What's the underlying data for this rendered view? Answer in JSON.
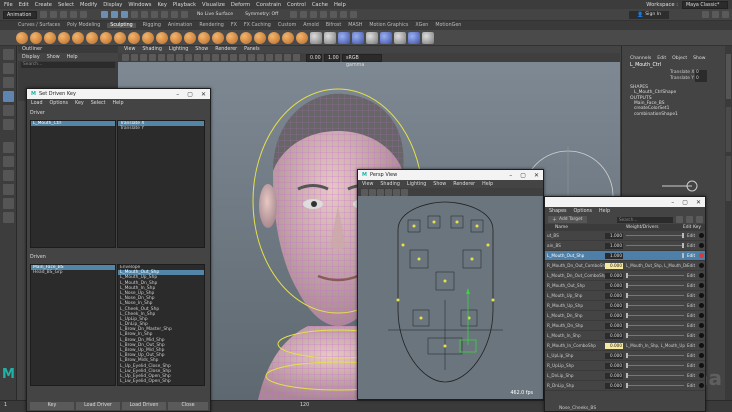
{
  "menubar": {
    "items": [
      "File",
      "Edit",
      "Create",
      "Select",
      "Modify",
      "Display",
      "Windows",
      "Key",
      "Playback",
      "Visualize",
      "Deform",
      "Constrain",
      "Control",
      "Cache",
      "Help"
    ],
    "workspace_label": "Workspace :",
    "workspace_value": "Maya Classic*"
  },
  "statusline": {
    "mode": "Animation",
    "no_live_surface": "No Live Surface",
    "symmetry": "Symmetry: Off",
    "sign_in": "Sign In"
  },
  "shelf": {
    "tabs": [
      "Curves / Surfaces",
      "Poly Modeling",
      "Sculpting",
      "Rigging",
      "Animation",
      "Rendering",
      "FX",
      "FX Caching",
      "Custom",
      "Arnold",
      "Bifrost",
      "MASH",
      "Motion Graphics",
      "XGen",
      "MotionGen"
    ],
    "active_tab": "Sculpting"
  },
  "outliner": {
    "title": "Outliner",
    "menu": [
      "Display",
      "Show",
      "Help"
    ],
    "search_placeholder": "Search..."
  },
  "viewport": {
    "menu": [
      "View",
      "Shading",
      "Lighting",
      "Show",
      "Renderer",
      "Panels"
    ],
    "colorspace": "sRGB gamma",
    "val_a": "0.00",
    "val_b": "1.00"
  },
  "sdk": {
    "title": "Set Driven Key",
    "menu": [
      "Load",
      "Options",
      "Key",
      "Select",
      "Help"
    ],
    "driver_label": "Driver",
    "driver_object": "L_Mouth_Ctrl",
    "driver_attrs": [
      "Translate X",
      "Translate Y"
    ],
    "driven_label": "Driven",
    "driven_objects": [
      "Main_Face_BS",
      "Head_BS_Grp"
    ],
    "driven_attrs": [
      "Envelope",
      "L_Mouth_Out_Shp",
      "L_Mouth_Up_Shp",
      "L_Mouth_Dn_Shp",
      "L_Mouth_In_Shp",
      "L_Nose_Up_Shp",
      "L_Nose_Dn_Shp",
      "L_Nose_In_Shp",
      "L_Cheek_Out_Shp",
      "L_Cheek_In_Shp",
      "L_UpLip_Shp",
      "L_DnLip_Shp",
      "L_Brow_Dn_Master_Shp",
      "L_Brow_In_Shp",
      "L_Brow_Dn_Mid_Shp",
      "L_Brow_Dn_Out_Shp",
      "L_Brow_Up_Mid_Shp",
      "L_Brow_Up_Out_Shp",
      "L_Brow_Mids_Shp",
      "L_Up_Eyelid_Close_Shp",
      "L_Lw_Eyelid_Close_Shp",
      "L_Up_Eyelid_Open_Shp",
      "L_Lw_Eyelid_Open_Shp"
    ],
    "buttons": [
      "Key",
      "Load Driver",
      "Load Driven",
      "Close"
    ]
  },
  "persp": {
    "title": "Persp View",
    "menu": [
      "View",
      "Shading",
      "Lighting",
      "Show",
      "Renderer",
      "Help"
    ],
    "fps": "462.0 fps"
  },
  "shape_editor": {
    "menu": [
      "Shapes",
      "Options",
      "Help"
    ],
    "add_target": "Add Target",
    "search_placeholder": "Search...",
    "col_name": "Name",
    "col_weight": "Weight/Drivers",
    "col_edit": "Edit",
    "col_key": "Key",
    "rows": [
      {
        "name": "ut_BS",
        "value": "1.000",
        "slider": 1.0,
        "yellow": false,
        "driver": "",
        "selected": false,
        "key": "dark"
      },
      {
        "name": "ain_BS",
        "value": "1.000",
        "slider": 1.0,
        "yellow": false,
        "driver": "",
        "selected": false,
        "key": "dark"
      },
      {
        "name": "L_Mouth_Out_Shp",
        "value": "1.000",
        "slider": 1.0,
        "yellow": false,
        "driver": "",
        "selected": true,
        "key": "red"
      },
      {
        "name": "R_Mouth_Dn_Out_ComboShp",
        "value": "0.000",
        "slider": 0,
        "yellow": true,
        "driver": "L_Mouth_Out_Shp, L_Mouth_Dn",
        "selected": false,
        "key": "dark"
      },
      {
        "name": "L_Mouth_Dn_Out_ComboShp",
        "value": "0.000",
        "slider": 0,
        "yellow": false,
        "driver": "",
        "selected": false,
        "key": "dark"
      },
      {
        "name": "R_Mouth_Out_Shp",
        "value": "0.000",
        "slider": 0,
        "yellow": false,
        "driver": "",
        "selected": false,
        "key": "dark"
      },
      {
        "name": "L_Mouth_Up_Shp",
        "value": "0.000",
        "slider": 0,
        "yellow": false,
        "driver": "",
        "selected": false,
        "key": "dark"
      },
      {
        "name": "R_Mouth_Up_Shp",
        "value": "0.000",
        "slider": 0,
        "yellow": false,
        "driver": "",
        "selected": false,
        "key": "dark"
      },
      {
        "name": "L_Mouth_Dn_Shp",
        "value": "0.000",
        "slider": 0,
        "yellow": false,
        "driver": "",
        "selected": false,
        "key": "dark"
      },
      {
        "name": "R_Mouth_Dn_Shp",
        "value": "0.000",
        "slider": 0,
        "yellow": false,
        "driver": "",
        "selected": false,
        "key": "dark"
      },
      {
        "name": "L_Mouth_In_Shp",
        "value": "0.000",
        "slider": 0,
        "yellow": false,
        "driver": "",
        "selected": false,
        "key": "dark"
      },
      {
        "name": "R_Mouth_In_ComboShp",
        "value": "0.000",
        "slider": 0,
        "yellow": true,
        "driver": "L_Mouth_In_Shp, L_Mouth_Up",
        "selected": false,
        "key": "dark"
      },
      {
        "name": "L_UpLip_Shp",
        "value": "0.000",
        "slider": 0,
        "yellow": false,
        "driver": "",
        "selected": false,
        "key": "dark"
      },
      {
        "name": "R_UpLip_Shp",
        "value": "0.000",
        "slider": 0,
        "yellow": false,
        "driver": "",
        "selected": false,
        "key": "dark"
      },
      {
        "name": "L_DnLip_Shp",
        "value": "0.000",
        "slider": 0,
        "yellow": false,
        "driver": "",
        "selected": false,
        "key": "dark"
      },
      {
        "name": "R_DnLip_Shp",
        "value": "0.000",
        "slider": 0,
        "yellow": false,
        "driver": "",
        "selected": false,
        "key": "dark"
      }
    ],
    "group_label": "Nose_Cheeks_BS"
  },
  "channelbox": {
    "tabs": [
      "Channels",
      "Edit",
      "Object",
      "Show"
    ],
    "object": "L_Mouth_Ctrl",
    "attrs": [
      {
        "name": "Translate X",
        "value": "0"
      },
      {
        "name": "Translate Y",
        "value": "0"
      }
    ],
    "shapes_label": "SHAPES",
    "shapes": [
      "L_Mouth_CtrlShape"
    ],
    "outputs_label": "OUTPUTS",
    "outputs": [
      "Main_Face_BS",
      "createColorSet1",
      "combinationShape1"
    ]
  },
  "timeline": {
    "start": "1",
    "current": "120"
  },
  "colors": {
    "accent": "#5285a6",
    "wire": "#c56bd6",
    "highlight": "#f5e9a0"
  },
  "watermark": "Cinema"
}
